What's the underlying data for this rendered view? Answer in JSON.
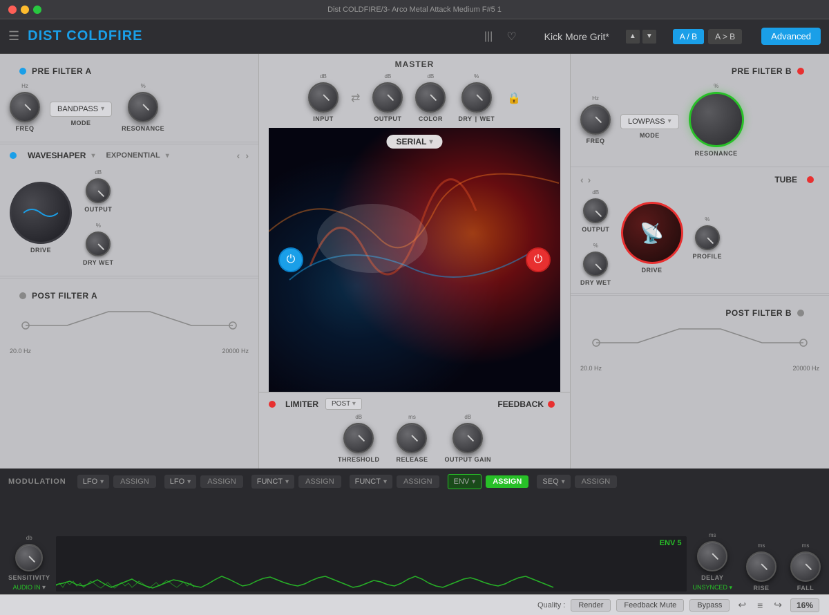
{
  "titlebar": {
    "text": "Dist COLDFIRE/3- Arco Metal Attack Medium F#5 1"
  },
  "toolbar": {
    "title": "DIST COLDFIRE",
    "preset": "Kick More Grit*",
    "ab_a": "A / B",
    "ab_b": "A > B",
    "advanced": "Advanced"
  },
  "preFilterA": {
    "title": "PRE FILTER A",
    "freqLabel": "FREQ",
    "modeLabel": "MODE",
    "modeValue": "BANDPASS",
    "resonanceLabel": "RESONANCE",
    "hzUnit": "Hz",
    "pctUnit": "%"
  },
  "master": {
    "title": "MASTER",
    "inputLabel": "INPUT",
    "outputLabel": "OUTPUT",
    "colorLabel": "COLOR",
    "dryLabel": "DRY",
    "wetLabel": "WET",
    "dbUnit": "dB",
    "pctUnit": "%"
  },
  "preFilterB": {
    "title": "PRE FILTER B",
    "freqLabel": "FREQ",
    "modeLabel": "MODE",
    "modeValue": "LOWPASS",
    "resonanceLabel": "RESONANCE",
    "hzUnit": "Hz",
    "pctUnit": "%"
  },
  "waveshaper": {
    "title": "WAVESHAPER",
    "type": "EXPONENTIAL",
    "outputLabel": "OUTPUT",
    "dryWetLabel": "DRY WET",
    "driveLabel": "DRIVE",
    "dbUnit": "dB",
    "pctUnit": "%"
  },
  "serial": {
    "label": "SERIAL"
  },
  "tube": {
    "title": "TUBE",
    "outputLabel": "OUTPUT",
    "dryWetLabel": "DRY WET",
    "driveLabel": "DRIVE",
    "profileLabel": "PROFILE",
    "dbUnit": "dB",
    "pctUnit": "%"
  },
  "postFilterA": {
    "title": "POST FILTER A",
    "hzMin": "20.0 Hz",
    "hzMax": "20000 Hz"
  },
  "limiter": {
    "title": "LIMITER",
    "postLabel": "POST",
    "thresholdLabel": "THRESHOLD",
    "releaseLabel": "RELEASE",
    "outputGainLabel": "OUTPUT GAIN",
    "dbUnit": "dB",
    "msUnit": "ms"
  },
  "feedback": {
    "title": "FEEDBACK"
  },
  "postFilterB": {
    "title": "POST FILTER B",
    "hzMin": "20.0 Hz",
    "hzMax": "20000 Hz"
  },
  "modulation": {
    "title": "MODULATION",
    "slots": [
      {
        "type": "LFO",
        "assign": "ASSIGN",
        "active": false
      },
      {
        "type": "LFO",
        "assign": "ASSIGN",
        "active": false
      },
      {
        "type": "FUNCT",
        "assign": "ASSIGN",
        "active": false
      },
      {
        "type": "FUNCT",
        "assign": "ASSIGN",
        "active": false
      },
      {
        "type": "ENV",
        "assign": "ASSIGN",
        "active": true
      },
      {
        "type": "SEQ",
        "assign": "ASSIGN",
        "active": false
      }
    ],
    "envLabel": "ENV 5",
    "sensitivityLabel": "SENSITIVITY",
    "audioInLabel": "AUDIO IN",
    "delayLabel": "DELAY",
    "riseLabel": "RISE",
    "fallLabel": "FALL",
    "msUnit": "ms"
  },
  "statusBar": {
    "qualityLabel": "Quality :",
    "renderBtn": "Render",
    "feedbackMuteBtn": "Feedback Mute",
    "bypassBtn": "Bypass",
    "zoomPct": "16%"
  }
}
